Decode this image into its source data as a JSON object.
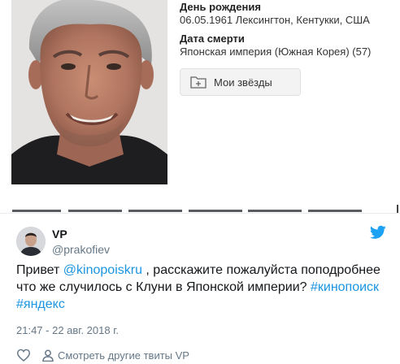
{
  "profile": {
    "birth_label": "День рождения",
    "birth_value": "06.05.1961 Лексингтон, Кентукки, США",
    "death_label": "Дата смерти",
    "death_value": "Японская империя (Южная Корея) (57)",
    "stars_button": "Мои звёзды"
  },
  "tweet": {
    "author_name": "VP",
    "author_handle": "@prakofiev",
    "body": {
      "t1": "Привет ",
      "mention": "@kinopoiskru",
      "t2": " , расскажите пожалуйста поподробнее что же случилось с Клуни в Японской империи? ",
      "hashtag1": "#кинопоиск",
      "hashtag2": "#яндекс"
    },
    "timestamp": "21:47 - 22 авг. 2018 г.",
    "more_tweets": "Смотреть другие твиты VP"
  },
  "colors": {
    "link": "#1b95e0",
    "muted": "#657786",
    "twitter_blue": "#1da1f2"
  },
  "icons": [
    "folder-plus-icon",
    "twitter-bird-icon",
    "heart-icon",
    "user-icon"
  ]
}
